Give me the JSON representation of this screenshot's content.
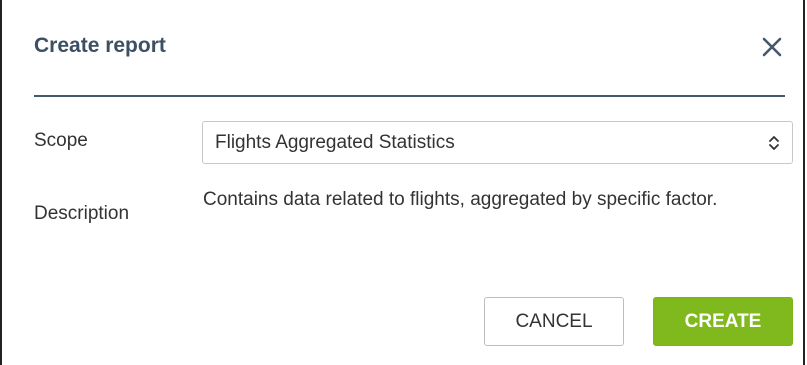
{
  "dialog": {
    "title": "Create report",
    "close_icon": "close-icon"
  },
  "form": {
    "scope_label": "Scope",
    "scope_value": "Flights Aggregated Statistics",
    "scope_icon": "updown-caret-icon",
    "description_label": "Description",
    "description_text": "Contains data related to flights, aggregated by specific factor."
  },
  "buttons": {
    "cancel_label": "CANCEL",
    "create_label": "CREATE"
  },
  "colors": {
    "title": "#3d4f63",
    "divider": "#44586c",
    "create_button": "#80b91e"
  }
}
